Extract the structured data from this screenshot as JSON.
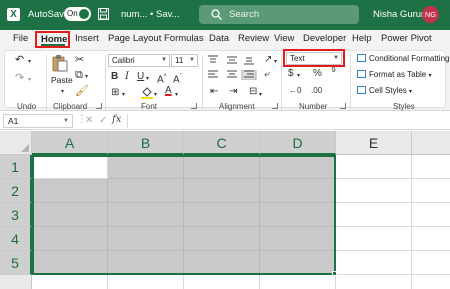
{
  "titlebar": {
    "autosave_label": "AutoSave",
    "toggle_state": "On",
    "filename": "num... • Sav...",
    "search_placeholder": "Search",
    "user_name": "Nisha Gurung",
    "user_initials": "NG",
    "accent_color": "#1e7145"
  },
  "tabs": {
    "file": "File",
    "home": "Home",
    "insert": "Insert",
    "page_layout": "Page Layout",
    "formulas": "Formulas",
    "data": "Data",
    "review": "Review",
    "view": "View",
    "developer": "Developer",
    "help": "Help",
    "power_pivot": "Power Pivot"
  },
  "ribbon": {
    "undo_label": "Undo",
    "clipboard_label": "Clipboard",
    "paste_label": "Paste",
    "font_label": "Font",
    "font_name": "Calibri",
    "font_size": "11",
    "alignment_label": "Alignment",
    "number_label": "Number",
    "number_format": "Text",
    "styles_label": "Styles",
    "conditional_formatting": "Conditional Formatting",
    "format_as_table": "Format as Table",
    "cell_styles": "Cell Styles"
  },
  "formula_bar": {
    "name_box": "A1",
    "fx": "fx",
    "content": ""
  },
  "grid": {
    "columns": [
      "A",
      "B",
      "C",
      "D",
      "E"
    ],
    "rows": [
      "1",
      "2",
      "3",
      "4",
      "5"
    ],
    "selected_range": "A1:D5",
    "active_cell": "A1"
  }
}
